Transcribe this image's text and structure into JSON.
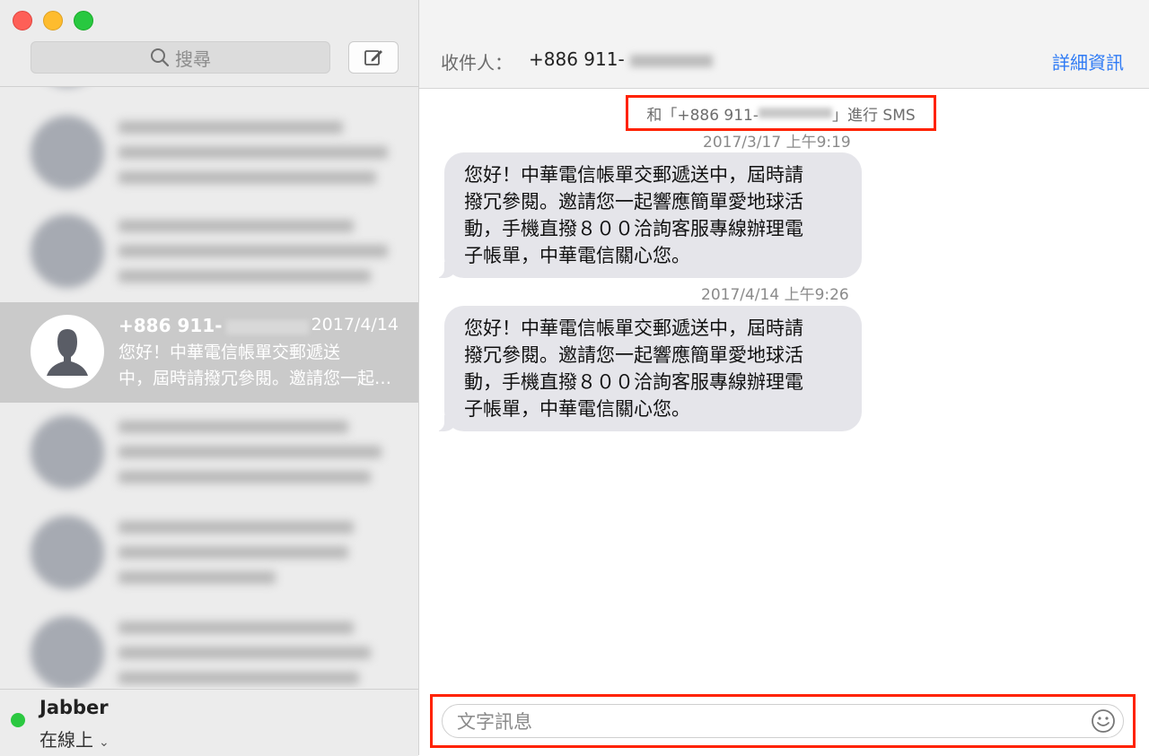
{
  "sidebar": {
    "search_placeholder": "搜尋",
    "selected_conversation": {
      "name": "+886 911-",
      "date": "2017/4/14",
      "preview_line1": "您好！中華電信帳單交郵遞送",
      "preview_line2": "中，屆時請撥冗參閱。邀請您一起…"
    },
    "account": {
      "name": "Jabber",
      "status": "在線上"
    }
  },
  "header": {
    "to_label": "收件人：",
    "to_value": "+886 911-",
    "details_label": "詳細資訊"
  },
  "chat": {
    "sms_note_prefix": "和「+886 911-",
    "sms_note_suffix": "」進行 SMS",
    "messages": [
      {
        "timestamp": "2017/3/17 上午9:19",
        "lines": [
          "您好！中華電信帳單交郵遞送中，屆時請",
          "撥冗參閱。邀請您一起響應簡單愛地球活",
          "動，手機直撥８００洽詢客服專線辦理電",
          "子帳單，中華電信關心您。"
        ]
      },
      {
        "timestamp": "2017/4/14 上午9:26",
        "lines": [
          "您好！中華電信帳單交郵遞送中，屆時請",
          "撥冗參閱。邀請您一起響應簡單愛地球活",
          "動，手機直撥８００洽詢客服專線辦理電",
          "子帳單，中華電信關心您。"
        ]
      }
    ],
    "input_placeholder": "文字訊息"
  },
  "colors": {
    "accent": "#2f7bf5",
    "highlight_border": "#ff2200",
    "online": "#2bc840"
  }
}
